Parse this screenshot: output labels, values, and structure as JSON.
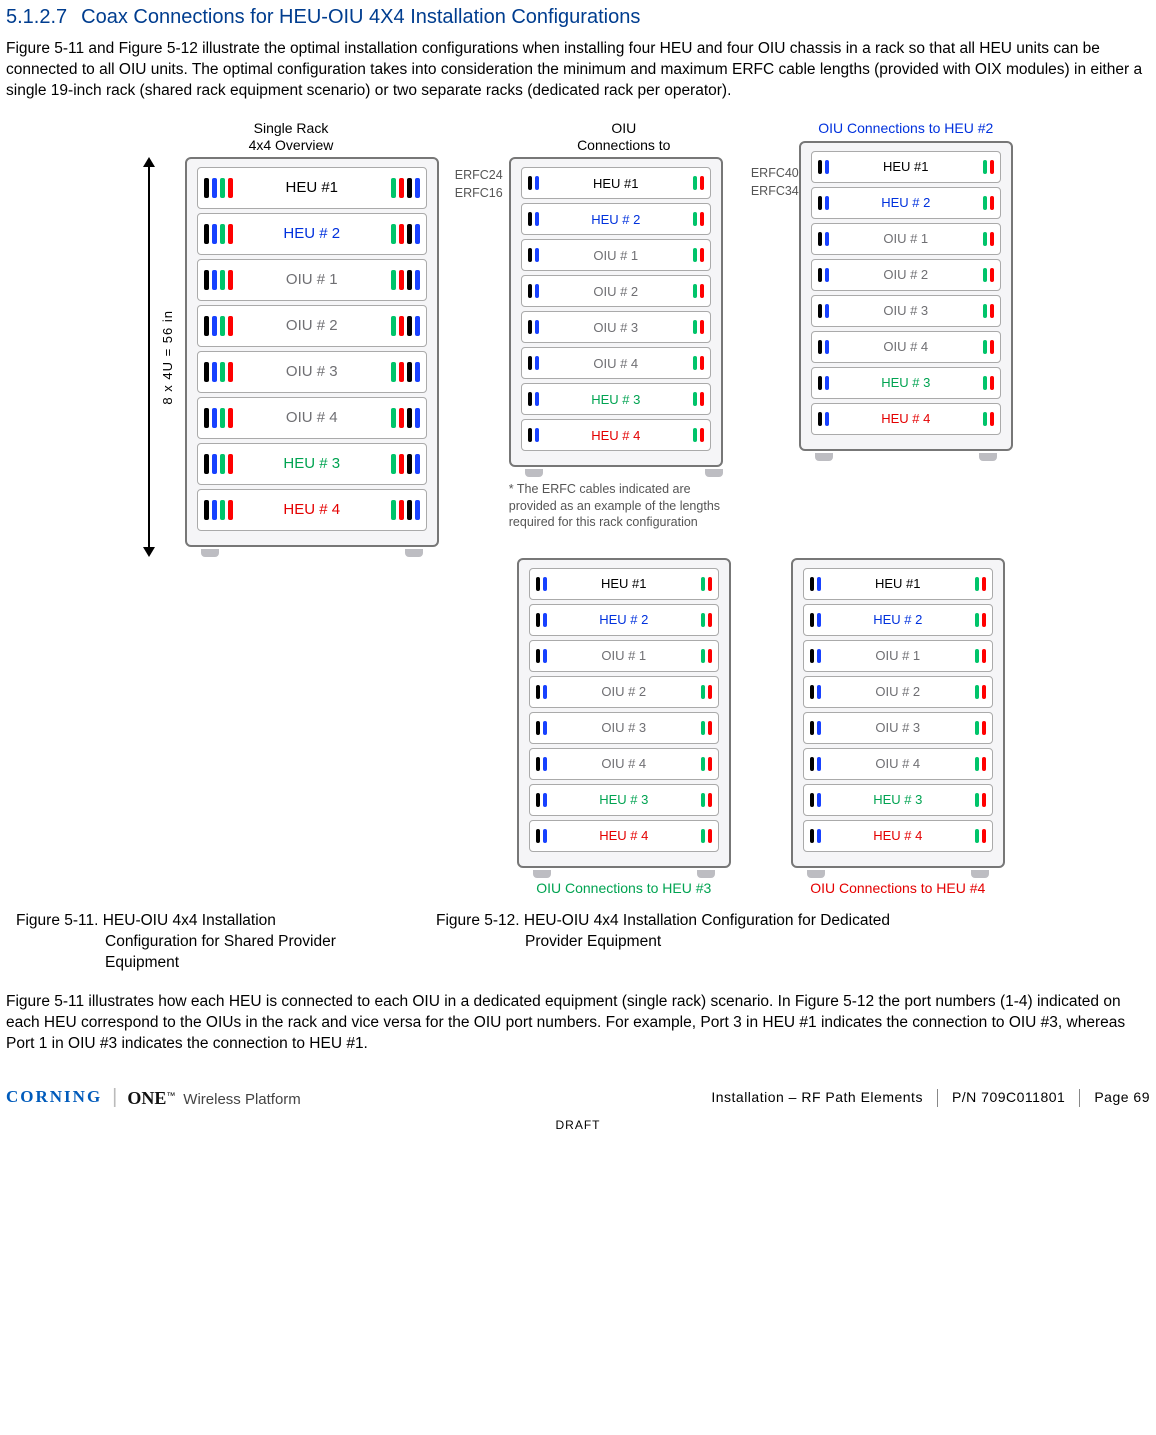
{
  "heading": {
    "number": "5.1.2.7",
    "title": "Coax Connections for HEU-OIU 4X4 Installation Configurations"
  },
  "para1": "Figure 5-11 and Figure 5-12 illustrate the optimal installation configurations when installing four HEU and four OIU chassis in a rack so that all HEU units can be connected to all OIU units. The optimal configuration takes into consideration the minimum and maximum ERFC cable lengths (provided with OIX modules) in either a single 19-inch rack (shared rack equipment scenario) or two separate racks (dedicated rack per operator).",
  "bigRack": {
    "title_l1": "Single Rack",
    "title_l2": "4x4 Overview",
    "dim": "8 x 4U = 56 in",
    "units": [
      "HEU #1",
      "HEU # 2",
      "OIU # 1",
      "OIU # 2",
      "OIU # 3",
      "OIU # 4",
      "HEU # 3",
      "HEU # 4"
    ]
  },
  "smallRacks": {
    "units": [
      "HEU #1",
      "HEU # 2",
      "OIU # 1",
      "OIU # 2",
      "OIU # 3",
      "OIU # 4",
      "HEU # 3",
      "HEU # 4"
    ],
    "titles": {
      "tl_l1": "OIU",
      "tl_l2": "Connections to",
      "tr": "OIU Connections to HEU #2",
      "bl": "OIU Connections to HEU #3",
      "br": "OIU Connections to HEU #4"
    },
    "erfc": {
      "l_top": "ERFC24",
      "l_bot": "ERFC16",
      "r_top": "ERFC40",
      "r_bot": "ERFC34"
    },
    "footnote": "* The ERFC cables indicated are provided as an example of the lengths required for this rack configuration"
  },
  "captions": {
    "c1": "Figure 5-11. HEU-OIU 4x4 Installation",
    "c1b": "Configuration for Shared Provider Equipment",
    "c2": "Figure 5-12. HEU-OIU 4x4 Installation Configuration for Dedicated",
    "c2b": "Provider Equipment"
  },
  "para2": "Figure 5-11 illustrates how each HEU is connected to each OIU in a dedicated equipment (single rack) scenario. In Figure 5-12 the port numbers (1-4) indicated on each HEU correspond to the OIUs in the rack and vice versa for the OIU port numbers. For example, Port 3 in HEU #1 indicates the connection to OIU #3, whereas Port 1 in OIU #3 indicates the connection to HEU #1.",
  "footer": {
    "brand_corning": "CORNING",
    "brand_one": "ONE",
    "brand_suffix": "Wireless Platform",
    "section": "Installation – RF Path Elements",
    "pn": "P/N 709C011801",
    "page": "Page 69",
    "draft": "DRAFT"
  }
}
